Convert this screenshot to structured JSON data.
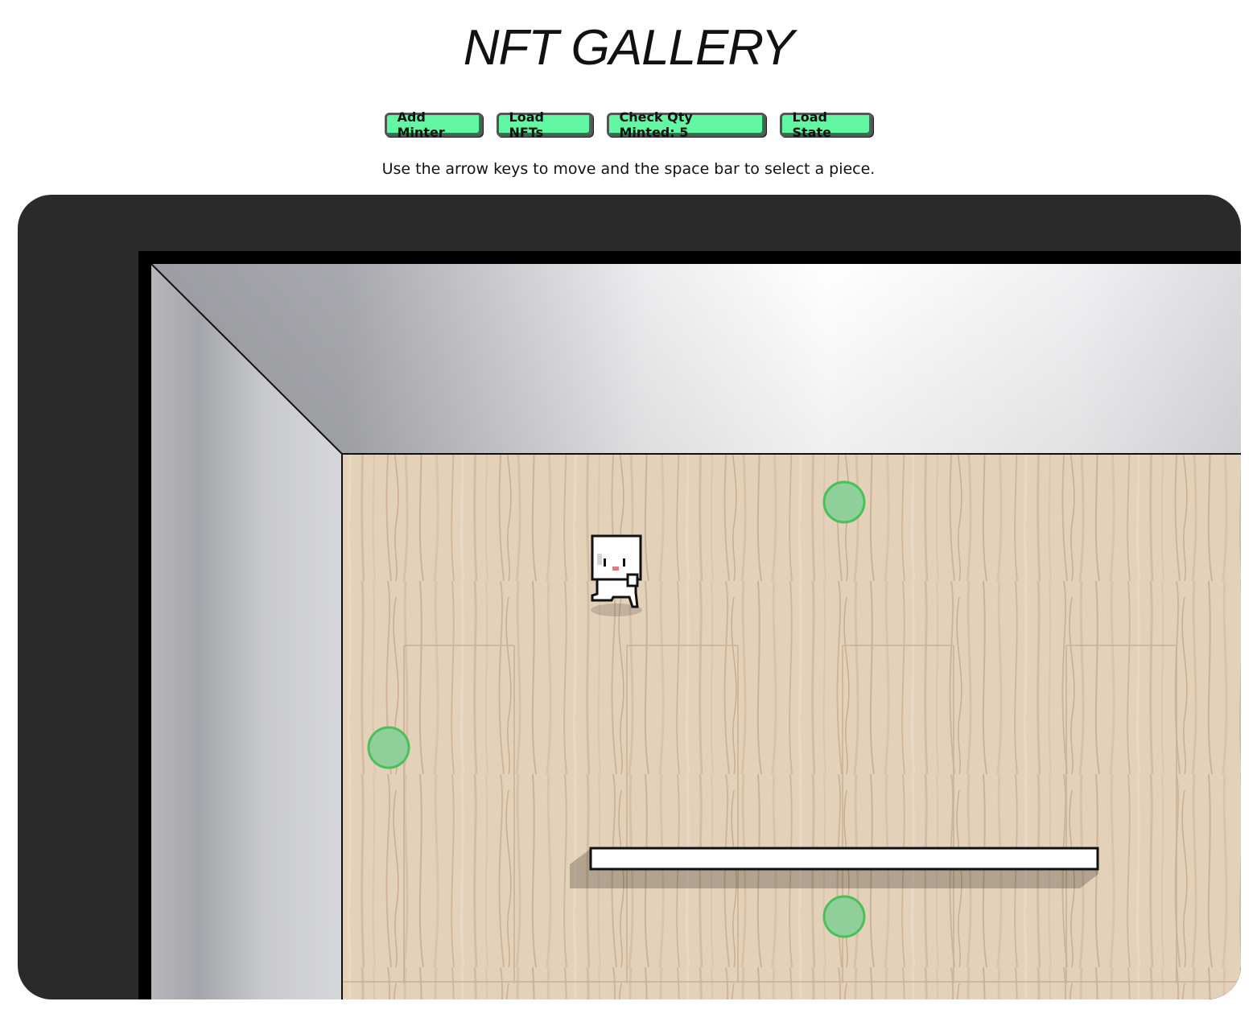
{
  "title": "NFT GALLERY",
  "toolbar": {
    "buttons": [
      {
        "label": "Add Minter"
      },
      {
        "label": "Load NFTs"
      },
      {
        "label": "Check Qty Minted: 5"
      },
      {
        "label": "Load State"
      }
    ]
  },
  "instructions": "Use the arrow keys to move and the space bar to select a piece.",
  "game": {
    "colors": {
      "frame": "#2a2a2a",
      "floor": "#e2cfb8",
      "wall": "#c8c9cc",
      "marker": "#8fcf9a",
      "marker_border": "#4cbf5a"
    },
    "markers": [
      {
        "name": "marker-top"
      },
      {
        "name": "marker-left"
      },
      {
        "name": "marker-bottom"
      }
    ],
    "character": {
      "icon": "ghost-character-icon"
    },
    "bench": {
      "icon": "bench-icon"
    }
  }
}
